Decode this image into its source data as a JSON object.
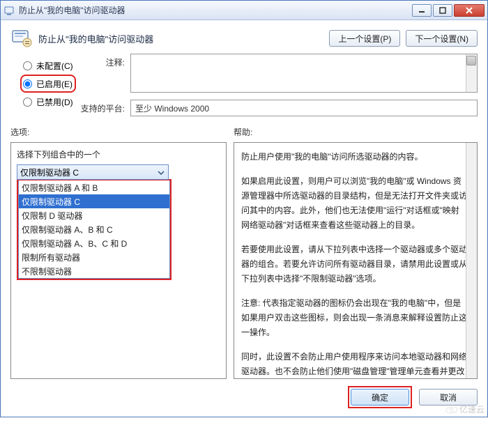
{
  "window": {
    "title": "防止从\"我的电脑\"访问驱动器"
  },
  "header": {
    "text": "防止从\"我的电脑\"访问驱动器",
    "prev_btn": "上一个设置(P)",
    "next_btn": "下一个设置(N)"
  },
  "radios": {
    "unconfigured": "未配置(C)",
    "enabled": "已启用(E)",
    "disabled": "已禁用(D)"
  },
  "labels": {
    "comment": "注释:",
    "platform": "支持的平台:",
    "platform_value": "至少 Windows 2000",
    "options": "选项:",
    "help": "帮助:"
  },
  "options_panel": {
    "heading": "选择下列组合中的一个",
    "selected": "仅限制驱动器 C",
    "items": [
      "仅限制驱动器 A 和 B",
      "仅限制驱动器 C",
      "仅限制 D 驱动器",
      "仅限制驱动器 A、B 和 C",
      "仅限制驱动器 A、B、C 和 D",
      "限制所有驱动器",
      "不限制驱动器"
    ]
  },
  "help_panel": {
    "p1": "防止用户使用\"我的电脑\"访问所选驱动器的内容。",
    "p2": "如果启用此设置，则用户可以浏览\"我的电脑\"或 Windows 资源管理器中所选驱动器的目录结构，但是无法打开文件夹或访问其中的内容。此外，他们也无法使用\"运行\"对话框或\"映射网络驱动器\"对话框来查看这些驱动器上的目录。",
    "p3": "若要使用此设置，请从下拉列表中选择一个驱动器或多个驱动器的组合。若要允许访问所有驱动器目录，请禁用此设置或从下拉列表中选择\"不限制驱动器\"选项。",
    "p4": "注意: 代表指定驱动器的图标仍会出现在\"我的电脑\"中，但是如果用户双击这些图标，则会出现一条消息来解释设置防止这一操作。",
    "p5": "同时，此设置不会防止用户使用程序来访问本地驱动器和网络驱动器。也不会防止他们使用\"磁盘管理\"管理单元查看并更改驱动器特性。"
  },
  "footer": {
    "ok": "确定",
    "cancel": "取消"
  },
  "watermark": "亿速云"
}
